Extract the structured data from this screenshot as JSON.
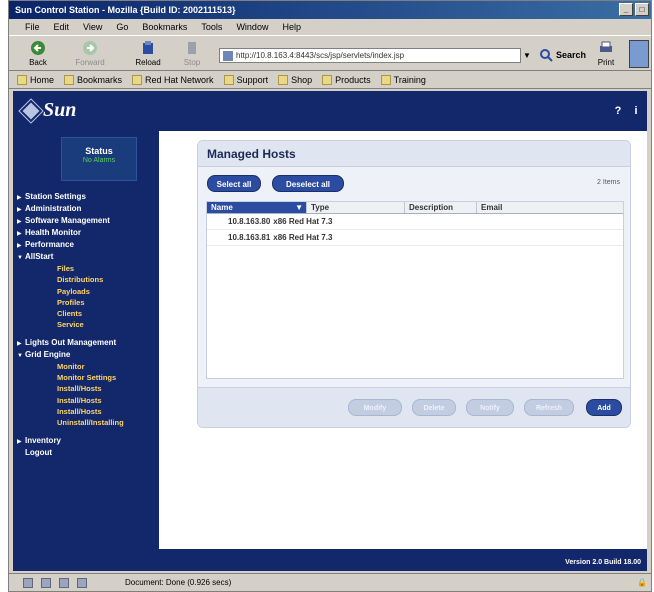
{
  "window": {
    "title": "Sun Control Station - Mozilla {Build ID: 2002111513}"
  },
  "menubar": [
    "File",
    "Edit",
    "View",
    "Go",
    "Bookmarks",
    "Tools",
    "Window",
    "Help"
  ],
  "toolbar": {
    "back": "Back",
    "forward": "Forward",
    "reload": "Reload",
    "stop": "Stop",
    "url": "http://10.8.163.4:8443/scs/jsp/servlets/index.jsp",
    "search": "Search",
    "print": "Print"
  },
  "bookmarks": [
    "Home",
    "Bookmarks",
    "Red Hat Network",
    "Support",
    "Shop",
    "Products",
    "Training"
  ],
  "sidebar": {
    "status_label": "Status",
    "status_value": "No Alarms",
    "items": [
      {
        "label": "Station Settings"
      },
      {
        "label": "Administration"
      },
      {
        "label": "Software Management"
      },
      {
        "label": "Health Monitor"
      },
      {
        "label": "Performance"
      },
      {
        "label": "AllStart",
        "expanded": true,
        "children": [
          "Files",
          "Distributions",
          "Payloads",
          "Profiles",
          "Clients",
          "Service"
        ]
      },
      {
        "label": "Lights Out Management"
      },
      {
        "label": "Grid Engine",
        "expanded": true,
        "children": [
          "Monitor",
          "Monitor Settings",
          "Install/Hosts",
          "Install/Hosts",
          "Install/Hosts",
          "Uninstall/Installing"
        ]
      },
      {
        "label": "Inventory"
      },
      {
        "label": "Logout"
      }
    ]
  },
  "panel": {
    "title": "Managed Hosts",
    "select_all": "Select all",
    "deselect_all": "Deselect all",
    "item_count": "2 Items",
    "columns": [
      "Name",
      "Type",
      "Description",
      "Email"
    ],
    "rows": [
      {
        "name": "10.8.163.80",
        "type": "x86 Red Hat 7.3"
      },
      {
        "name": "10.8.163.81",
        "type": "x86 Red Hat 7.3"
      }
    ],
    "footer_buttons": [
      "Modify",
      "Delete",
      "Notify",
      "Refresh",
      "Add"
    ]
  },
  "version": "Version 2.0 Build 18.00",
  "statusbar": {
    "text": "Document: Done (0.926 secs)"
  }
}
